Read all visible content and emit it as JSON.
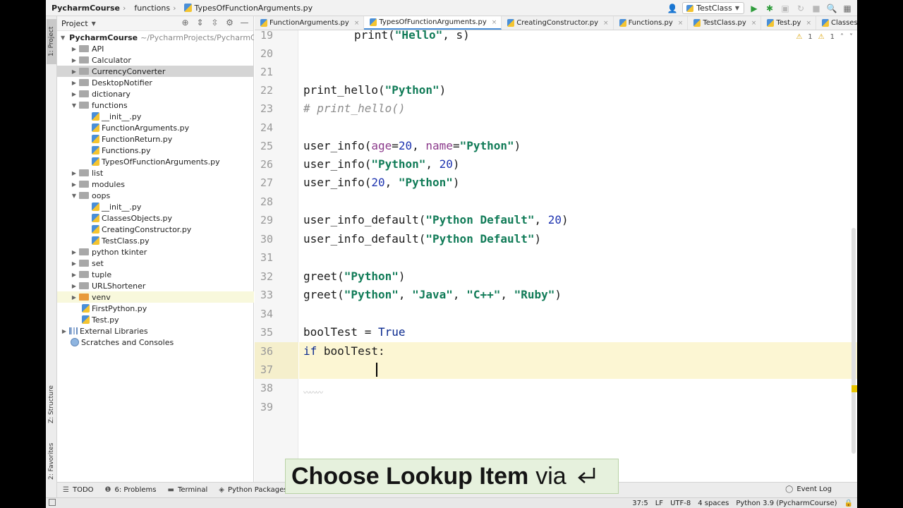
{
  "breadcrumb": {
    "project": "PycharmCourse",
    "folder": "functions",
    "file": "TypesOfFunctionArguments.py"
  },
  "toolbar": {
    "run_config": "TestClass"
  },
  "side_tabs": {
    "project": "1: Project",
    "structure": "Z: Structure",
    "favorites": "2: Favorites"
  },
  "project_panel": {
    "title": "Project",
    "root_name": "PycharmCourse",
    "root_path": "~/PycharmProjects/PycharmCo",
    "items": [
      {
        "label": "API"
      },
      {
        "label": "Calculator"
      },
      {
        "label": "CurrencyConverter"
      },
      {
        "label": "DesktopNotifier"
      },
      {
        "label": "dictionary"
      },
      {
        "label": "functions"
      },
      {
        "label": "__init__.py"
      },
      {
        "label": "FunctionArguments.py"
      },
      {
        "label": "FunctionReturn.py"
      },
      {
        "label": "Functions.py"
      },
      {
        "label": "TypesOfFunctionArguments.py"
      },
      {
        "label": "list"
      },
      {
        "label": "modules"
      },
      {
        "label": "oops"
      },
      {
        "label": "__init__.py"
      },
      {
        "label": "ClassesObjects.py"
      },
      {
        "label": "CreatingConstructor.py"
      },
      {
        "label": "TestClass.py"
      },
      {
        "label": "python tkinter"
      },
      {
        "label": "set"
      },
      {
        "label": "tuple"
      },
      {
        "label": "URLShortener"
      },
      {
        "label": "venv"
      },
      {
        "label": "FirstPython.py"
      },
      {
        "label": "Test.py"
      },
      {
        "label": "External Libraries"
      },
      {
        "label": "Scratches and Consoles"
      }
    ]
  },
  "tabs": [
    {
      "label": "FunctionArguments.py"
    },
    {
      "label": "TypesOfFunctionArguments.py"
    },
    {
      "label": "CreatingConstructor.py"
    },
    {
      "label": "Functions.py"
    },
    {
      "label": "TestClass.py"
    },
    {
      "label": "Test.py"
    },
    {
      "label": "ClassesObjects.py"
    }
  ],
  "inspections": {
    "warnings": "1",
    "weak": "1"
  },
  "editor": {
    "line_numbers": [
      "19",
      "20",
      "21",
      "22",
      "23",
      "24",
      "25",
      "26",
      "27",
      "28",
      "29",
      "30",
      "31",
      "32",
      "33",
      "34",
      "35",
      "36",
      "37",
      "38",
      "39"
    ],
    "line19": {
      "a": "print(",
      "b": "\"Hello\"",
      "c": ", s)"
    },
    "line22": {
      "a": "print_hello(",
      "b": "\"Python\"",
      "c": ")"
    },
    "line23": "# print_hello()",
    "line25": {
      "a": "user_info(",
      "p1": "age",
      "eq1": "=",
      "n1": "20",
      "s1": ", ",
      "p2": "name",
      "eq2": "=",
      "str": "\"Python\"",
      "e": ")"
    },
    "line26": {
      "a": "user_info(",
      "str": "\"Python\"",
      "m": ", ",
      "num": "20",
      "e": ")"
    },
    "line27": {
      "a": "user_info(",
      "num": "20",
      "m": ", ",
      "str": "\"Python\"",
      "e": ")"
    },
    "line29": {
      "a": "user_info_default(",
      "str": "\"Python Default\"",
      "m": ", ",
      "num": "20",
      "e": ")"
    },
    "line30": {
      "a": "user_info_default(",
      "str": "\"Python Default\"",
      "e": ")"
    },
    "line32": {
      "a": "greet(",
      "str": "\"Python\"",
      "e": ")"
    },
    "line33": {
      "a": "greet(",
      "s1": "\"Python\"",
      "c1": ", ",
      "s2": "\"Java\"",
      "c2": ", ",
      "s3": "\"C++\"",
      "c3": ", ",
      "s4": "\"Ruby\"",
      "e": ")"
    },
    "line35": {
      "a": "boolTest = ",
      "kw": "True"
    },
    "line36": {
      "kw": "if",
      "rest": " boolTest:"
    }
  },
  "tooltip": {
    "bold": "Choose Lookup Item",
    "via": "via"
  },
  "bottom_tools": [
    {
      "label": "TODO"
    },
    {
      "label": "6: Problems"
    },
    {
      "label": "Terminal"
    },
    {
      "label": "Python Packages"
    }
  ],
  "event_log": "Event Log",
  "status": {
    "position": "37:5",
    "line_sep": "LF",
    "encoding": "UTF-8",
    "indent": "4 spaces",
    "interpreter": "Python 3.9 (PycharmCourse)"
  }
}
